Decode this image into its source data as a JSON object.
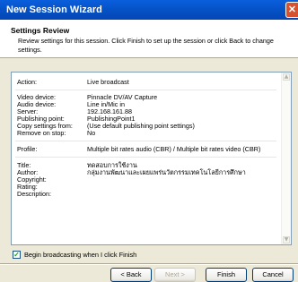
{
  "window": {
    "title": "New Session Wizard",
    "close_glyph": "✕",
    "close_icon": "close-icon"
  },
  "header": {
    "title": "Settings Review",
    "subtitle": "Review settings for this session. Click Finish to set up the session or click Back to change settings."
  },
  "summary": {
    "action": {
      "label": "Action:",
      "value": "Live broadcast"
    },
    "video_device": {
      "label": "Video device:",
      "value": "Pinnacle DV/AV Capture"
    },
    "audio_device": {
      "label": "Audio device:",
      "value": "Line in/Mic in"
    },
    "server": {
      "label": "Server:",
      "value": "192.168.161.88"
    },
    "publishing_point": {
      "label": "Publishing point:",
      "value": "PublishingPoint1"
    },
    "copy_settings": {
      "label": "Copy settings from:",
      "value": "(Use default publishing point settings)"
    },
    "remove_on_stop": {
      "label": "Remove on stop:",
      "value": "No"
    },
    "profile": {
      "label": "Profile:",
      "value": "Multiple bit rates audio (CBR) / Multiple bit rates video (CBR)"
    },
    "title": {
      "label": "Title:",
      "value": "ทดสอบการใช้งาน"
    },
    "author": {
      "label": "Author:",
      "value": "กลุ่มงานพัฒนาและเผยแพร่นวัตกรรมเทคโนโลยีการศึกษา"
    },
    "copyright": {
      "label": "Copyright:",
      "value": ""
    },
    "rating": {
      "label": "Rating:",
      "value": ""
    },
    "description": {
      "label": "Description:",
      "value": ""
    }
  },
  "checkbox": {
    "label": "Begin broadcasting when I click Finish",
    "checked": true,
    "glyph": "✓"
  },
  "buttons": {
    "back": "< Back",
    "next": "Next >",
    "finish": "Finish",
    "cancel": "Cancel"
  }
}
